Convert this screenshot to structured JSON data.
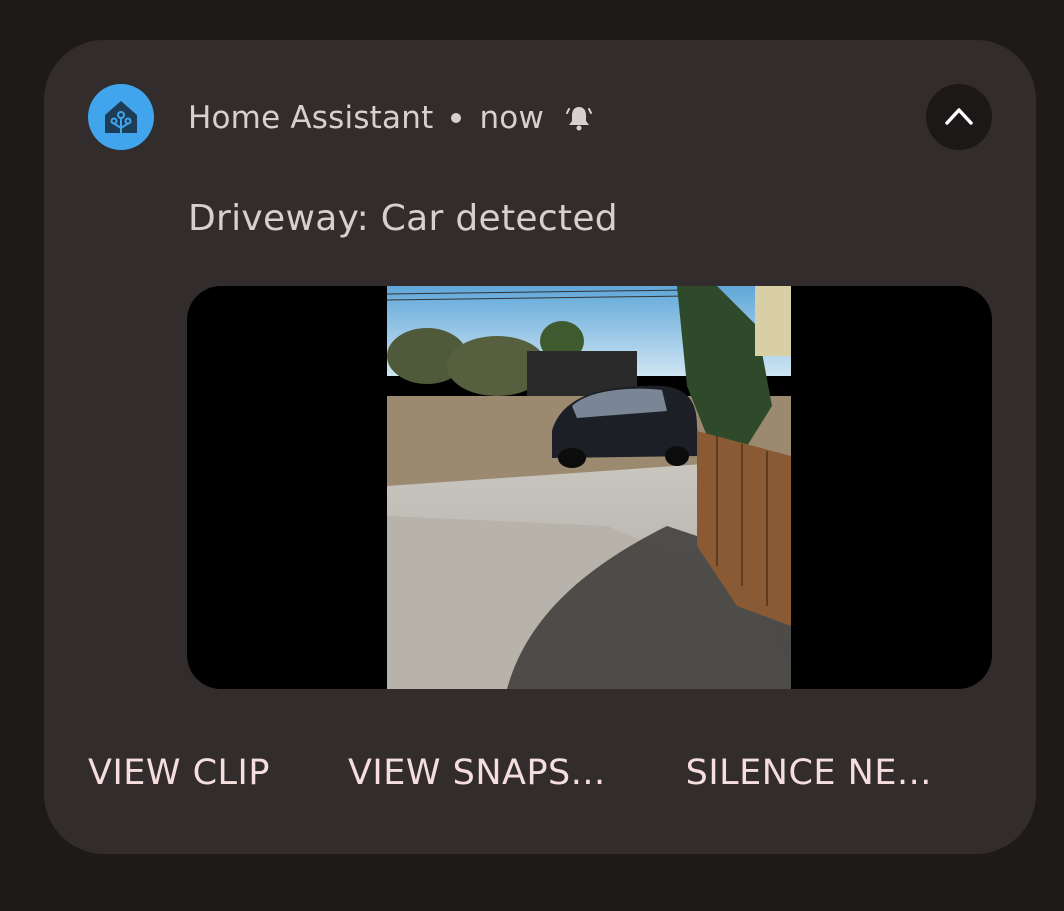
{
  "notification": {
    "app_name": "Home Assistant",
    "time": "now",
    "title": "Driveway: Car detected",
    "icons": {
      "app": "home-assistant-icon",
      "alert": "bell-ringing-icon",
      "collapse": "chevron-up-icon"
    },
    "colors": {
      "app_icon_bg": "#41a5ee",
      "card_bg": "#322d2c",
      "action_text": "#f5dedd"
    },
    "actions": [
      {
        "label": "VIEW CLIP"
      },
      {
        "label": "VIEW SNAPS..."
      },
      {
        "label": "SILENCE NE..."
      }
    ]
  }
}
